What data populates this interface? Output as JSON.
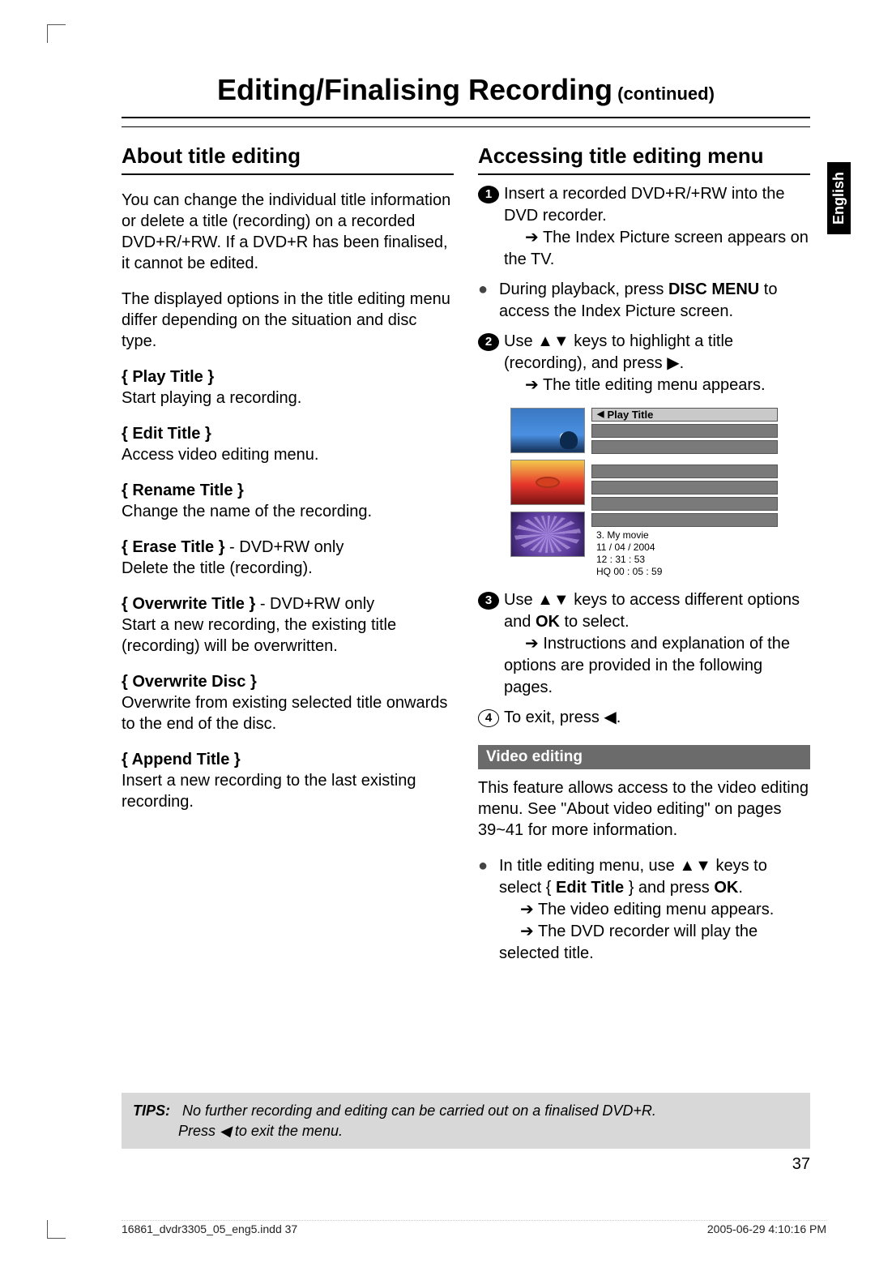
{
  "header": {
    "title": "Editing/Finalising Recording",
    "continued": " (continued)"
  },
  "lang_tab": "English",
  "left": {
    "heading": "About title editing",
    "p1": "You can change the individual title information or delete a title (recording) on a recorded DVD+R/+RW. If a DVD+R has been finalised, it cannot be edited.",
    "p2": "The displayed options in the title editing menu differ depending on the situation and disc type.",
    "opts": {
      "play_t": "{ Play Title }",
      "play_d": "Start playing a recording.",
      "edit_t": "{ Edit Title }",
      "edit_d": "Access video editing menu.",
      "rename_t": "{ Rename Title }",
      "rename_d": "Change the name of the recording.",
      "erase_t": "{ Erase Title }",
      "erase_suffix": " - DVD+RW only",
      "erase_d": "Delete the title (recording).",
      "overwrite_t": "{ Overwrite Title }",
      "overwrite_suffix": " - DVD+RW only",
      "overwrite_d": "Start a new recording, the existing title (recording) will be overwritten.",
      "odisc_t": "{ Overwrite Disc }",
      "odisc_d": "Overwrite from existing selected title onwards to the end of the disc.",
      "append_t": "{ Append Title }",
      "append_d": "Insert a new recording to the last existing recording."
    }
  },
  "right": {
    "heading": "Accessing title editing menu",
    "s1a": "Insert a recorded DVD+R/+RW into the DVD recorder.",
    "s1b": "The Index Picture screen appears on the TV.",
    "s1c_pre": "During playback, press ",
    "s1c_b": "DISC MENU",
    "s1c_post": " to access the Index Picture screen.",
    "s2a": "Use ▲▼ keys to highlight a title (recording), and press ▶.",
    "s2b": "The title editing menu appears.",
    "s3a_pre": "Use ▲▼ keys to access different options and ",
    "s3a_b": "OK",
    "s3a_post": " to select.",
    "s3b": "Instructions and explanation of the options are provided in the following pages.",
    "s4": "To exit, press ◀.",
    "video_heading": "Video editing",
    "video_p": "This feature allows access to the video editing menu. See \"About video editing\" on pages 39~41 for more information.",
    "ve_a_pre": "In title editing menu, use ▲▼ keys to select { ",
    "ve_a_b1": "Edit Title",
    "ve_a_mid": " } and press ",
    "ve_a_b2": "OK",
    "ve_a_post": ".",
    "ve_b": "The video editing menu appears.",
    "ve_c": "The DVD recorder will play the selected title."
  },
  "diagram": {
    "menu_label": "Play Title",
    "meta1": "3. My movie",
    "meta2": "11 / 04 / 2004",
    "meta3": "12 : 31 : 53",
    "meta4": "HQ 00 : 05 : 59"
  },
  "tips": {
    "label": "TIPS:",
    "line1": "No further recording and editing can be carried out on a finalised DVD+R.",
    "line2": "Press ◀ to exit the menu."
  },
  "page_number": "37",
  "footer": {
    "left": "16861_dvdr3305_05_eng5.indd   37",
    "right": "2005-06-29   4:10:16 PM"
  }
}
